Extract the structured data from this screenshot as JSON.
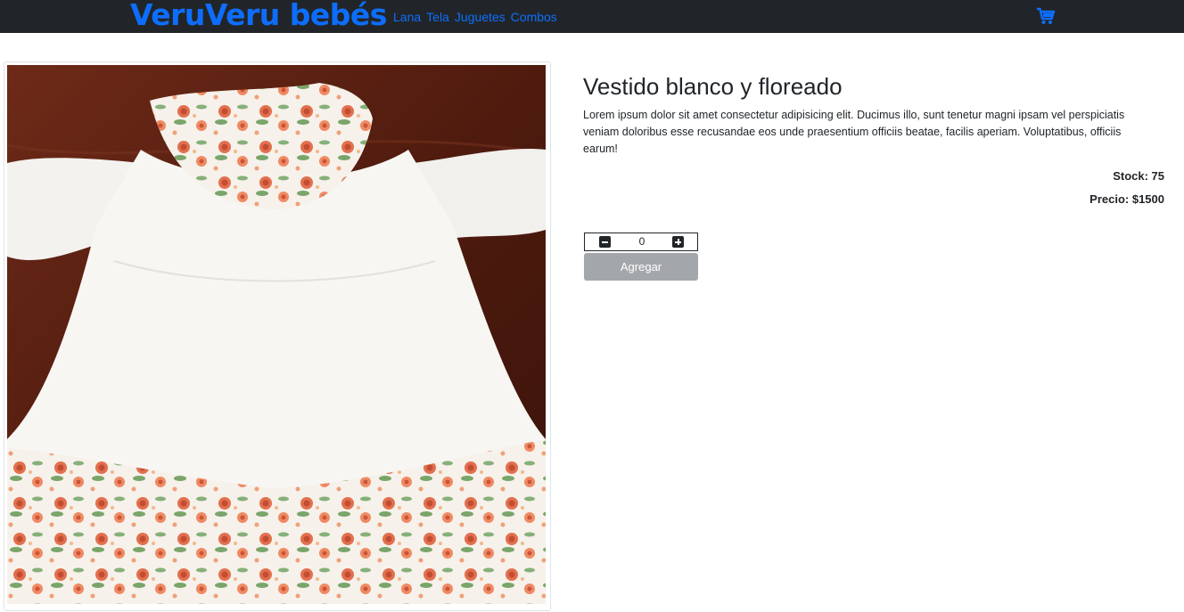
{
  "navbar": {
    "brand": "VeruVeru bebés",
    "links": [
      "Lana",
      "Tela",
      "Juguetes",
      "Combos"
    ],
    "cart_icon": "cart-icon"
  },
  "product": {
    "image_alt": "Vestido blanco y floreado",
    "title": "Vestido blanco y floreado",
    "description": "Lorem ipsum dolor sit amet consectetur adipisicing elit. Ducimus illo, sunt tenetur magni ipsam vel perspiciatis veniam doloribus esse recusandae eos unde praesentium officiis beatae, facilis aperiam. Voluptatibus, officiis earum!",
    "stock": "Stock: 75",
    "price": "Precio: $1500"
  },
  "counter": {
    "value": "0",
    "minus_icon": "minus-square-icon",
    "plus_icon": "plus-square-icon",
    "add_label": "Agregar"
  },
  "colors": {
    "navbar_bg": "#212529",
    "accent": "#0d6efd",
    "button_disabled": "#a3a7ab"
  }
}
